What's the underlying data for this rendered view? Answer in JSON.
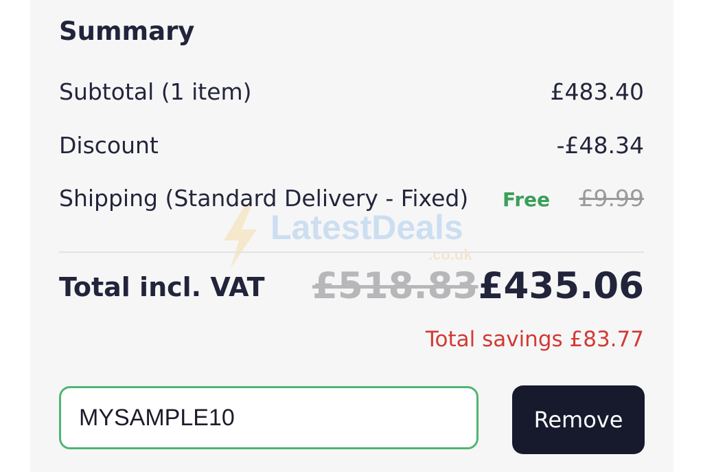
{
  "summary": {
    "title": "Summary",
    "subtotal": {
      "label": "Subtotal (1 item)",
      "value": "£483.40"
    },
    "discount": {
      "label": "Discount",
      "value": "-£48.34"
    },
    "shipping": {
      "label": "Shipping (Standard Delivery - Fixed)",
      "status": "Free",
      "original": "£9.99"
    },
    "total": {
      "label": "Total incl. VAT",
      "original": "£518.83",
      "value": "£435.06"
    },
    "savings": "Total savings £83.77"
  },
  "coupon": {
    "value": "MYSAMPLE10",
    "remove_label": "Remove"
  },
  "watermark": {
    "brand": "LatestDeals",
    "domain": ".co.uk",
    "icon": "lightning-bolt-icon"
  },
  "colors": {
    "text_primary": "#22243b",
    "free_green": "#3a9f5a",
    "savings_red": "#d23a33",
    "input_border_green": "#4fb571",
    "button_dark": "#171a2d"
  }
}
